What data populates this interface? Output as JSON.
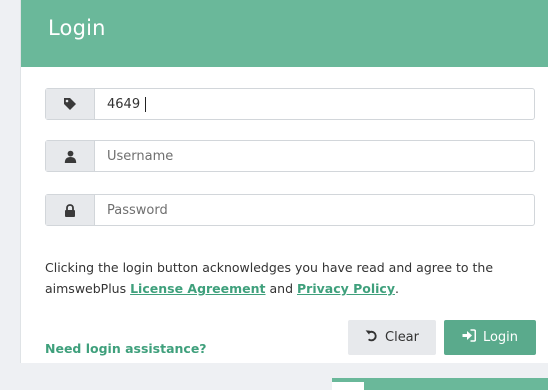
{
  "panel": {
    "title": "Login"
  },
  "fields": {
    "account": {
      "value": "4649",
      "placeholder": "",
      "icon": "tag-icon"
    },
    "username": {
      "value": "",
      "placeholder": "Username",
      "icon": "user-icon"
    },
    "password": {
      "value": "",
      "placeholder": "Password",
      "icon": "lock-icon"
    }
  },
  "notice": {
    "text_before": "Clicking the login button acknowledges you have read and agree to the aimswebPlus ",
    "license_link": "License Agreement",
    "text_middle": " and ",
    "privacy_link": "Privacy Policy",
    "text_after": "."
  },
  "assist": {
    "label": "Need login assistance?"
  },
  "buttons": {
    "clear_label": "Clear",
    "clear_icon": "undo-icon",
    "login_label": "Login",
    "login_icon": "sign-in-icon"
  },
  "colors": {
    "header": "#6ab89a",
    "link": "#3fa07c",
    "login_button": "#5aaa8c",
    "clear_button": "#e7e9ec"
  }
}
